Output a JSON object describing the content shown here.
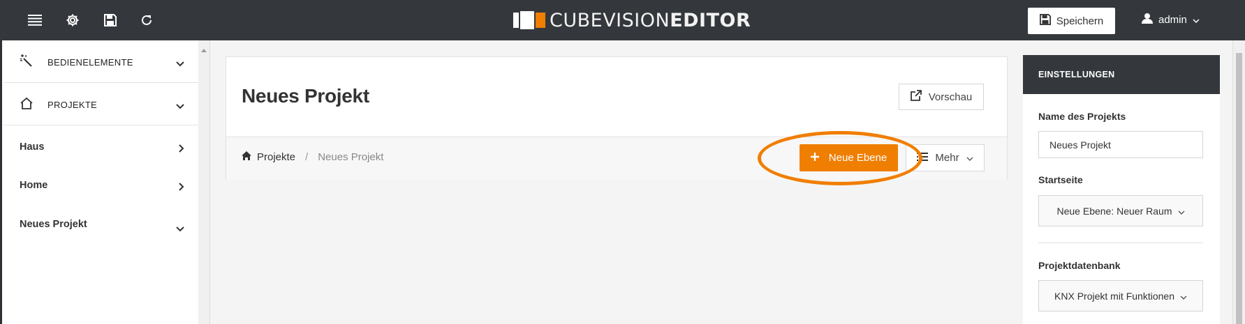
{
  "topbar": {
    "logo_light": "CUBEVISION",
    "logo_bold": "EDITOR",
    "save_label": "Speichern",
    "user_label": "admin",
    "icons": [
      "menu-icon",
      "gear-icon",
      "floppy-disk-icon",
      "refresh-icon"
    ]
  },
  "sidebar": {
    "sections": [
      {
        "label": "BEDIENELEMENTE",
        "icon": "magic-wand-icon"
      },
      {
        "label": "PROJEKTE",
        "icon": "home-outline-icon"
      }
    ],
    "items": [
      {
        "label": "Haus"
      },
      {
        "label": "Home"
      },
      {
        "label": "Neues Projekt",
        "active": true
      }
    ]
  },
  "main": {
    "title": "Neues Projekt",
    "preview_label": "Vorschau",
    "breadcrumb": [
      "Projekte",
      "Neues Projekt"
    ],
    "new_layer_label": "Neue Ebene",
    "more_label": "Mehr"
  },
  "settings": {
    "header": "EINSTELLUNGEN",
    "project_name_label": "Name des Projekts",
    "project_name_value": "Neues Projekt",
    "start_page_label": "Startseite",
    "start_page_value": "Neue Ebene: Neuer Raum",
    "database_label": "Projektdatenbank",
    "database_value": "KNX Projekt mit Funktionen"
  },
  "colors": {
    "topbar": "#34383c",
    "accent": "#f07e00"
  }
}
